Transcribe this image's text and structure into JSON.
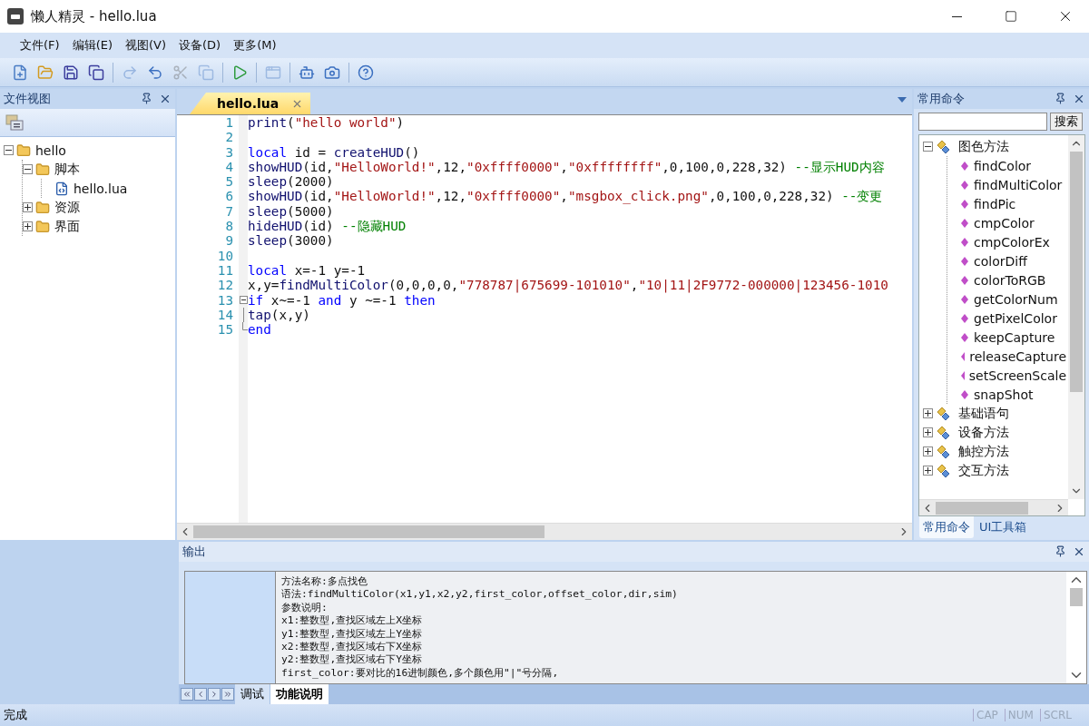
{
  "window": {
    "title": "懒人精灵 - hello.lua"
  },
  "menu": [
    {
      "label": "文件(F)"
    },
    {
      "label": "编辑(E)"
    },
    {
      "label": "视图(V)"
    },
    {
      "label": "设备(D)"
    },
    {
      "label": "更多(M)"
    }
  ],
  "toolbar": [
    {
      "kind": "new",
      "disabled": false
    },
    {
      "kind": "open",
      "disabled": false
    },
    {
      "kind": "save",
      "disabled": false
    },
    {
      "kind": "save-all",
      "disabled": false
    },
    {
      "kind": "sep"
    },
    {
      "kind": "redo",
      "disabled": true
    },
    {
      "kind": "undo",
      "disabled": false
    },
    {
      "kind": "cut",
      "disabled": true
    },
    {
      "kind": "copy",
      "disabled": true
    },
    {
      "kind": "sep"
    },
    {
      "kind": "run",
      "disabled": false
    },
    {
      "kind": "sep"
    },
    {
      "kind": "window",
      "disabled": true
    },
    {
      "kind": "sep"
    },
    {
      "kind": "android",
      "disabled": false
    },
    {
      "kind": "camera",
      "disabled": false
    },
    {
      "kind": "sep"
    },
    {
      "kind": "help",
      "disabled": false
    }
  ],
  "file_view": {
    "title": "文件视图",
    "tree": [
      {
        "label": "hello",
        "kind": "folder",
        "expanded": true,
        "children": [
          {
            "label": "脚本",
            "kind": "folder",
            "expanded": true,
            "children": [
              {
                "label": "hello.lua",
                "kind": "file"
              }
            ]
          },
          {
            "label": "资源",
            "kind": "folder",
            "expanded": false
          },
          {
            "label": "界面",
            "kind": "folder",
            "expanded": false
          }
        ]
      }
    ]
  },
  "editor": {
    "tabs": [
      {
        "label": "hello.lua",
        "selected": true
      }
    ],
    "lines": [
      {
        "number": "1",
        "tokens": [
          {
            "kind": "fn",
            "text": "print"
          },
          {
            "kind": "plain",
            "text": "("
          },
          {
            "kind": "str",
            "text": "\"hello world\""
          },
          {
            "kind": "plain",
            "text": ")"
          }
        ]
      },
      {
        "number": "2"
      },
      {
        "number": "3",
        "tokens": [
          {
            "kind": "kw",
            "text": "local"
          },
          {
            "kind": "plain",
            "text": " id = "
          },
          {
            "kind": "fn",
            "text": "createHUD"
          },
          {
            "kind": "plain",
            "text": "()"
          }
        ]
      },
      {
        "number": "4",
        "tokens": [
          {
            "kind": "fn",
            "text": "showHUD"
          },
          {
            "kind": "plain",
            "text": "(id,"
          },
          {
            "kind": "str",
            "text": "\"HelloWorld!\""
          },
          {
            "kind": "plain",
            "text": ",12,"
          },
          {
            "kind": "str",
            "text": "\"0xffff0000\""
          },
          {
            "kind": "plain",
            "text": ","
          },
          {
            "kind": "str",
            "text": "\"0xffffffff\""
          },
          {
            "kind": "plain",
            "text": ",0,100,0,228,32) "
          },
          {
            "kind": "cmt",
            "text": "--显示HUD内容"
          }
        ]
      },
      {
        "number": "5",
        "tokens": [
          {
            "kind": "fn",
            "text": "sleep"
          },
          {
            "kind": "plain",
            "text": "(2000)"
          }
        ]
      },
      {
        "number": "6",
        "tokens": [
          {
            "kind": "fn",
            "text": "showHUD"
          },
          {
            "kind": "plain",
            "text": "(id,"
          },
          {
            "kind": "str",
            "text": "\"HelloWorld!\""
          },
          {
            "kind": "plain",
            "text": ",12,"
          },
          {
            "kind": "str",
            "text": "\"0xffff0000\""
          },
          {
            "kind": "plain",
            "text": ","
          },
          {
            "kind": "str",
            "text": "\"msgbox_click.png\""
          },
          {
            "kind": "plain",
            "text": ",0,100,0,228,32) "
          },
          {
            "kind": "cmt",
            "text": "--变更"
          }
        ]
      },
      {
        "number": "7",
        "tokens": [
          {
            "kind": "fn",
            "text": "sleep"
          },
          {
            "kind": "plain",
            "text": "(5000)"
          }
        ]
      },
      {
        "number": "8",
        "tokens": [
          {
            "kind": "fn",
            "text": "hideHUD"
          },
          {
            "kind": "plain",
            "text": "(id) "
          },
          {
            "kind": "cmt",
            "text": "--隐藏HUD"
          }
        ]
      },
      {
        "number": "9",
        "tokens": [
          {
            "kind": "fn",
            "text": "sleep"
          },
          {
            "kind": "plain",
            "text": "(3000)"
          }
        ]
      },
      {
        "number": "10"
      },
      {
        "number": "11",
        "tokens": [
          {
            "kind": "kw",
            "text": "local"
          },
          {
            "kind": "plain",
            "text": " x=-1 y=-1"
          }
        ]
      },
      {
        "number": "12",
        "tokens": [
          {
            "kind": "plain",
            "text": "x,y="
          },
          {
            "kind": "fn",
            "text": "findMultiColor"
          },
          {
            "kind": "plain",
            "text": "(0,0,0,0,"
          },
          {
            "kind": "str",
            "text": "\"778787|675699-101010\""
          },
          {
            "kind": "plain",
            "text": ","
          },
          {
            "kind": "str",
            "text": "\"10|11|2F9772-000000|123456-1010"
          }
        ]
      },
      {
        "number": "13",
        "kind": "fold-start",
        "tokens": [
          {
            "kind": "kw",
            "text": "if"
          },
          {
            "kind": "plain",
            "text": " x~=-1 "
          },
          {
            "kind": "kw",
            "text": "and"
          },
          {
            "kind": "plain",
            "text": " y ~=-1 "
          },
          {
            "kind": "kw",
            "text": "then"
          }
        ]
      },
      {
        "number": "14",
        "kind": "fold-body",
        "tokens": [
          {
            "kind": "fn",
            "text": "tap"
          },
          {
            "kind": "plain",
            "text": "(x,y)"
          }
        ]
      },
      {
        "number": "15",
        "kind": "fold-end",
        "tokens": [
          {
            "kind": "kw",
            "text": "end"
          }
        ]
      }
    ]
  },
  "commands": {
    "title": "常用命令",
    "search_button": "搜索",
    "groups": [
      {
        "label": "图色方法",
        "expanded": true,
        "children": [
          {
            "label": "findColor"
          },
          {
            "label": "findMultiColor"
          },
          {
            "label": "findPic"
          },
          {
            "label": "cmpColor"
          },
          {
            "label": "cmpColorEx"
          },
          {
            "label": "colorDiff"
          },
          {
            "label": "colorToRGB"
          },
          {
            "label": "getColorNum"
          },
          {
            "label": "getPixelColor"
          },
          {
            "label": "keepCapture"
          },
          {
            "label": "releaseCapture"
          },
          {
            "label": "setScreenScale"
          },
          {
            "label": "snapShot"
          }
        ]
      },
      {
        "label": "基础语句",
        "expanded": false
      },
      {
        "label": "设备方法",
        "expanded": false
      },
      {
        "label": "触控方法",
        "expanded": false
      },
      {
        "label": "交互方法",
        "expanded": false
      }
    ],
    "tabs": [
      {
        "label": "常用命令",
        "selected": true
      },
      {
        "label": "UI工具箱",
        "selected": false
      }
    ]
  },
  "output": {
    "title": "输出",
    "lines": [
      "方法名称:多点找色",
      "语法:findMultiColor(x1,y1,x2,y2,first_color,offset_color,dir,sim)",
      "参数说明:",
      "x1:整数型,查找区域左上X坐标",
      "y1:整数型,查找区域左上Y坐标",
      "x2:整数型,查找区域右下X坐标",
      "y2:整数型,查找区域右下Y坐标",
      "first_color:要对比的16进制颜色,多个颜色用\"|\"号分隔,"
    ],
    "tabs": [
      {
        "label": "调试",
        "selected": false
      },
      {
        "label": "功能说明",
        "selected": true
      }
    ]
  },
  "status_bar": {
    "text": "完成",
    "indicators": [
      {
        "label": "CAP",
        "on": false
      },
      {
        "label": "NUM",
        "on": false
      },
      {
        "label": "SCRL",
        "on": false
      }
    ]
  }
}
